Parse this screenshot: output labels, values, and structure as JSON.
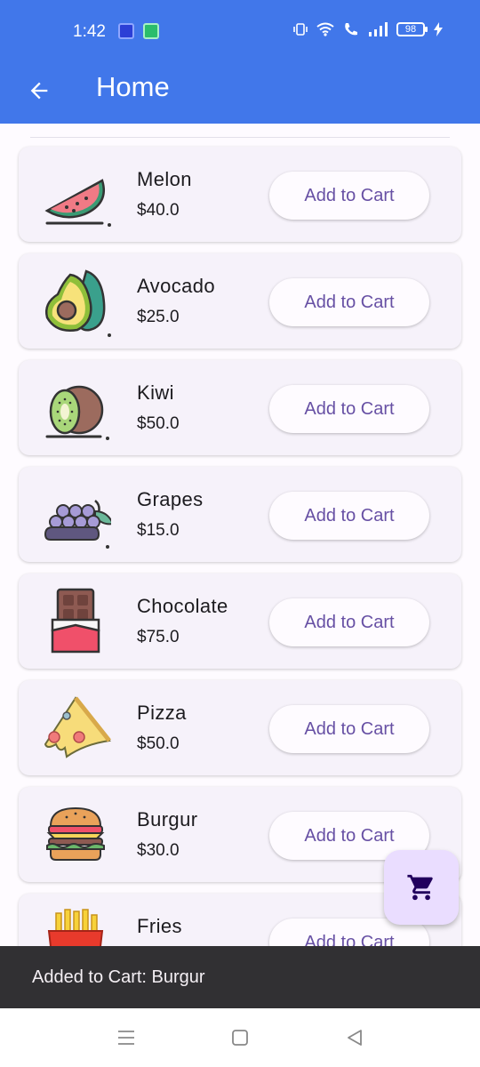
{
  "status_bar": {
    "time": "1:42",
    "battery": "98"
  },
  "app_bar": {
    "title": "Home"
  },
  "products": [
    {
      "name": "Melon",
      "price": "$40.0",
      "button": "Add to Cart",
      "icon": "watermelon-icon"
    },
    {
      "name": "Avocado",
      "price": "$25.0",
      "button": "Add to Cart",
      "icon": "avocado-icon"
    },
    {
      "name": "Kiwi",
      "price": "$50.0",
      "button": "Add to Cart",
      "icon": "kiwi-icon"
    },
    {
      "name": "Grapes",
      "price": "$15.0",
      "button": "Add to Cart",
      "icon": "grapes-icon"
    },
    {
      "name": "Chocolate",
      "price": "$75.0",
      "button": "Add to Cart",
      "icon": "chocolate-icon"
    },
    {
      "name": "Pizza",
      "price": "$50.0",
      "button": "Add to Cart",
      "icon": "pizza-icon"
    },
    {
      "name": "Burgur",
      "price": "$30.0",
      "button": "Add to Cart",
      "icon": "burger-icon"
    },
    {
      "name": "Fries",
      "price": "",
      "button": "Add to Cart",
      "icon": "fries-icon"
    }
  ],
  "fab": {
    "icon": "shopping-cart-icon"
  },
  "snackbar": {
    "message": "Added to Cart: Burgur"
  },
  "colors": {
    "app_bar": "#4177ea",
    "button_text": "#6750a4",
    "card": "#f6f2fa",
    "fab": "#eaddff",
    "snackbar": "#313033"
  }
}
